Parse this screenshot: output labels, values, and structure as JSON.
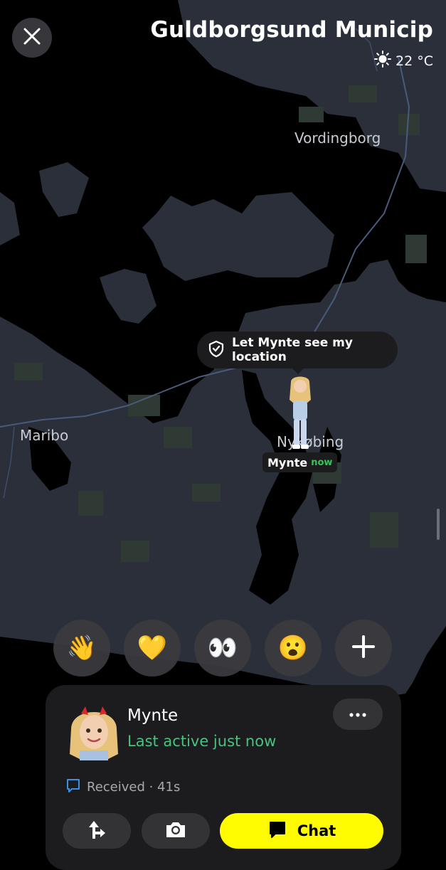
{
  "map": {
    "region_title": "Guldborgsund Municip",
    "weather": {
      "icon": "sun-icon",
      "temperature": "22 °C"
    },
    "places": [
      "Vordingborg",
      "Maribo",
      "Nykøbing"
    ],
    "share_prompt": {
      "icon": "location-share-icon",
      "label": "Let Mynte see my location"
    },
    "friend_marker": {
      "name": "Mynte",
      "status": "now"
    }
  },
  "reactions": [
    {
      "name": "wave-emoji",
      "emoji": "👋"
    },
    {
      "name": "yellow-heart-emoji",
      "emoji": "💛"
    },
    {
      "name": "eyes-emoji",
      "emoji": "👀"
    },
    {
      "name": "surprised-emoji",
      "emoji": "😮"
    },
    {
      "name": "add-reaction",
      "emoji": "+"
    }
  ],
  "card": {
    "name": "Mynte",
    "status": "Last active just now",
    "received": "Received · 41s",
    "chat_label": "Chat"
  },
  "colors": {
    "land": "#2a2f3a",
    "water": "#000000",
    "road": "#4a5a7a",
    "chat_button": "#fffc00",
    "status_green": "#4cc080"
  }
}
